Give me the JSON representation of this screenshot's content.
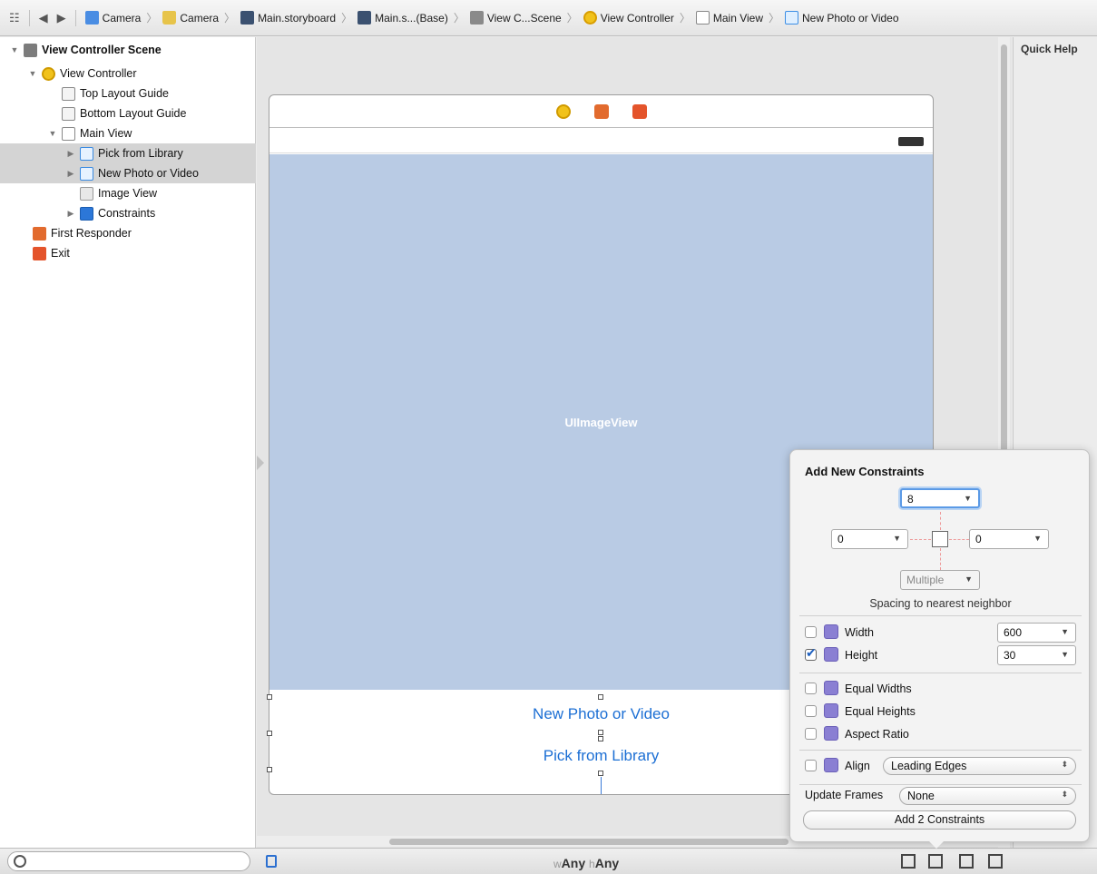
{
  "breadcrumbs": [
    "Camera",
    "Camera",
    "Main.storyboard",
    "Main.s...(Base)",
    "View C...Scene",
    "View Controller",
    "Main View",
    "New Photo or Video"
  ],
  "outline": {
    "items": [
      {
        "label": "View Controller Scene"
      },
      {
        "label": "View Controller"
      },
      {
        "label": "Top Layout Guide"
      },
      {
        "label": "Bottom Layout Guide"
      },
      {
        "label": "Main View"
      },
      {
        "label": "Pick from Library"
      },
      {
        "label": "New Photo or Video"
      },
      {
        "label": "Image View"
      },
      {
        "label": "Constraints"
      },
      {
        "label": "First Responder"
      },
      {
        "label": "Exit"
      }
    ]
  },
  "canvas": {
    "image_view_label": "UIImageView",
    "button_new": "New Photo or Video",
    "button_library": "Pick from Library"
  },
  "quick_help": {
    "title": "Quick Help"
  },
  "bottom_bar": {
    "size_w_prefix": "w",
    "size_w": "Any",
    "size_h_prefix": "h",
    "size_h": "Any"
  },
  "popover": {
    "title": "Add New Constraints",
    "top_value": "8",
    "left_value": "0",
    "right_value": "0",
    "bottom_value": "Multiple",
    "spacing_label": "Spacing to nearest neighbor",
    "width_label": "Width",
    "width_value": "600",
    "width_checked": false,
    "height_label": "Height",
    "height_value": "30",
    "height_checked": true,
    "equal_widths": "Equal Widths",
    "equal_heights": "Equal Heights",
    "aspect_ratio": "Aspect Ratio",
    "align_label": "Align",
    "align_value": "Leading Edges",
    "update_frames_label": "Update Frames",
    "update_frames_value": "None",
    "add_button": "Add 2 Constraints"
  }
}
